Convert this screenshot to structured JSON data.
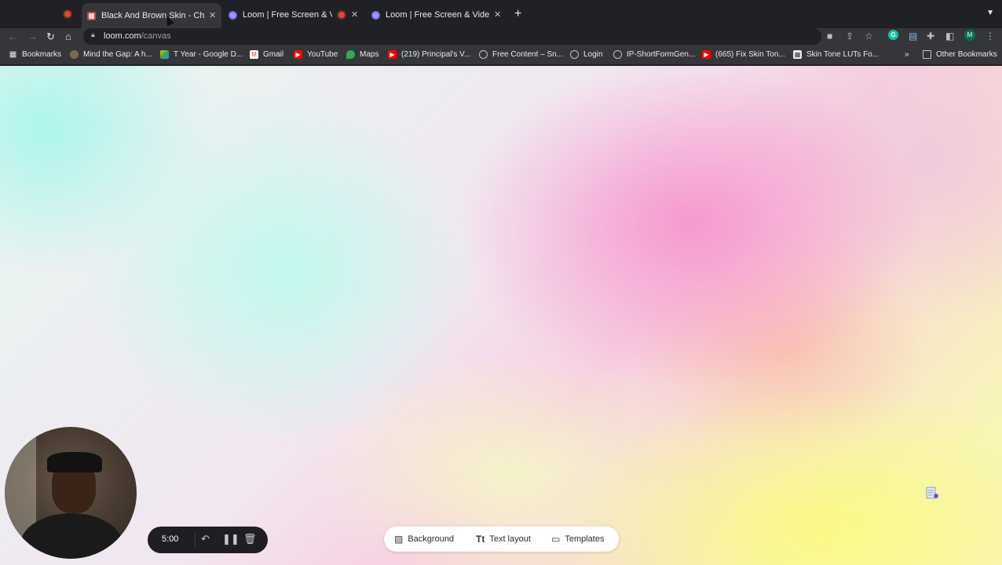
{
  "tabs": [
    {
      "title": "Black And Brown Skin - Chrome",
      "recording": false,
      "favicon": "tabs-icon"
    },
    {
      "title": "Loom | Free Screen & Video",
      "recording": true,
      "favicon": "loom-icon"
    },
    {
      "title": "Loom | Free Screen & Video Re",
      "recording": false,
      "favicon": "loom-icon"
    }
  ],
  "omnibox": {
    "domain": "loom.com",
    "path": "/canvas"
  },
  "bookmarks_bar": {
    "root_label": "Bookmarks",
    "items": [
      "Mind the Gap: A h...",
      "T Year - Google D...",
      "Gmail",
      "YouTube",
      "Maps",
      "(219) Principal's V...",
      "Free Content – Sn...",
      "Login",
      "IP-ShortFormGen...",
      "(665) Fix Skin Ton...",
      "Skin Tone LUTs Fo..."
    ],
    "overflow": "»",
    "other_label": "Other Bookmarks"
  },
  "profile": {
    "initial": "M"
  },
  "extensions": {
    "grammarly_initial": "G"
  },
  "recorder": {
    "timer": "5:00"
  },
  "canvas_toolbar": {
    "background": "Background",
    "text_layout": "Text layout",
    "templates": "Templates",
    "text_layout_icon_text": "Tt"
  },
  "colors": {
    "loom_purple": "#625df5",
    "recording_red": "#ea4335"
  }
}
